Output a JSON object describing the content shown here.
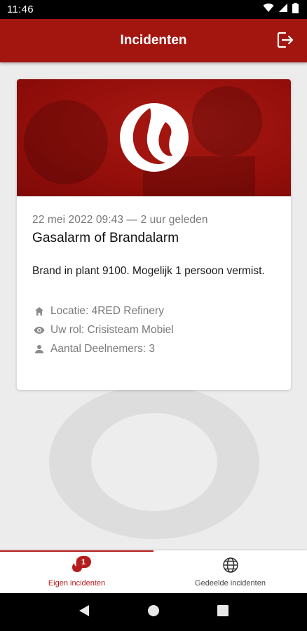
{
  "status_bar": {
    "time": "11:46",
    "icons": [
      "wifi-icon",
      "signal-icon",
      "battery-icon"
    ]
  },
  "app_bar": {
    "title": "Incidenten",
    "logout_icon": "logout-icon"
  },
  "incident_card": {
    "image_icon": "flame-logo-icon",
    "timestamp": "22 mei 2022 09:43 — 2 uur geleden",
    "title": "Gasalarm of Brandalarm",
    "description": "Brand in plant 9100. Mogelijk 1 persoon vermist.",
    "meta": [
      {
        "icon": "home-icon",
        "text": "Locatie: 4RED Refinery"
      },
      {
        "icon": "eye-icon",
        "text": "Uw rol: Crisisteam Mobiel"
      },
      {
        "icon": "person-icon",
        "text": "Aantal Deelnemers: 3"
      }
    ]
  },
  "bottom_nav": {
    "items": [
      {
        "label": "Eigen incidenten",
        "icon": "flame-icon",
        "badge": "1",
        "active": true
      },
      {
        "label": "Gedeelde incidenten",
        "icon": "globe-icon",
        "active": false
      }
    ]
  },
  "system_nav": {
    "icons": [
      "back-icon",
      "home-button-icon",
      "recents-icon"
    ]
  },
  "colors": {
    "primary": "#a3150f",
    "accent": "#b71c1c",
    "background": "#ececec",
    "muted_text": "#7a7a7a"
  }
}
